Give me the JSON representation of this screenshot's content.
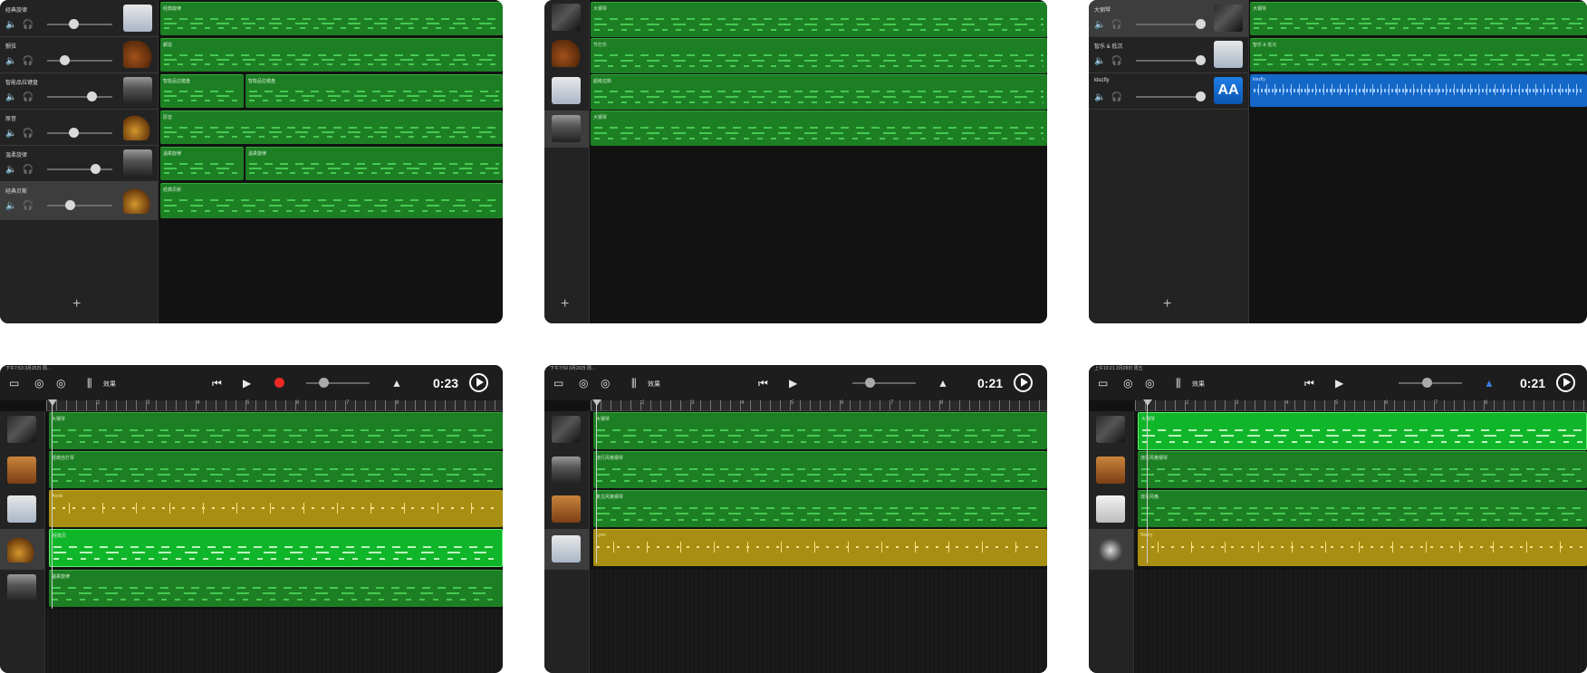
{
  "icons": {
    "mute": "🔈",
    "solo": "🎧",
    "add": "+",
    "rewind": "⏮",
    "play": "▶",
    "doc": "▭",
    "loop": "◎",
    "mixer": "⫼",
    "metronome": "▲"
  },
  "card1": {
    "tracks": [
      {
        "name": "经典旋律",
        "region": "经典旋律"
      },
      {
        "name": "颤弦",
        "region": "颤弦"
      },
      {
        "name": "智能品拉键盘",
        "region": "智能品拉键盘",
        "region2": "智能品拉键盘"
      },
      {
        "name": "原音",
        "region": "原音"
      },
      {
        "name": "温柔旋律",
        "region": "温柔旋律",
        "region2": "温柔旋律"
      },
      {
        "name": "经典贝斯",
        "region": "经典贝斯"
      }
    ]
  },
  "card2": {
    "regions": [
      "大钢琴",
      "节打乐",
      "超级拉斯",
      "大钢琴"
    ]
  },
  "card3": {
    "tracks": [
      {
        "name": "大钢琴",
        "region": "大钢琴"
      },
      {
        "name": "智乐 & 低沉",
        "region": "智乐 & 低沉"
      },
      {
        "name": "klezfly",
        "region": "klezfly"
      }
    ],
    "aa_label": "AA"
  },
  "card4": {
    "status": "下午7:53  3月25日 周...",
    "fx_label": "效果",
    "time": "0:23",
    "ruler": [
      "2",
      "3",
      "4",
      "5",
      "6",
      "7",
      "8"
    ],
    "regions": [
      "大钢琴",
      "经典自打琴",
      "Arctic",
      "经典贝",
      "温柔旋律"
    ]
  },
  "card5": {
    "status": "下午7:59  3月26日 周...",
    "fx_label": "效果",
    "time": "0:21",
    "ruler": [
      "2",
      "3",
      "4",
      "5",
      "6",
      "7",
      "8"
    ],
    "regions": [
      "大钢琴",
      "流行风格钢琴",
      "复古风格钢琴",
      "Lyon"
    ]
  },
  "card6": {
    "status": "上午10:21  3月28日 周五",
    "fx_label": "效果",
    "time": "0:21",
    "ruler": [
      "2",
      "3",
      "4",
      "5",
      "6",
      "7",
      "8"
    ],
    "regions": [
      "大钢琴",
      "流行风格钢琴",
      "流行风格",
      "Sterry"
    ]
  }
}
